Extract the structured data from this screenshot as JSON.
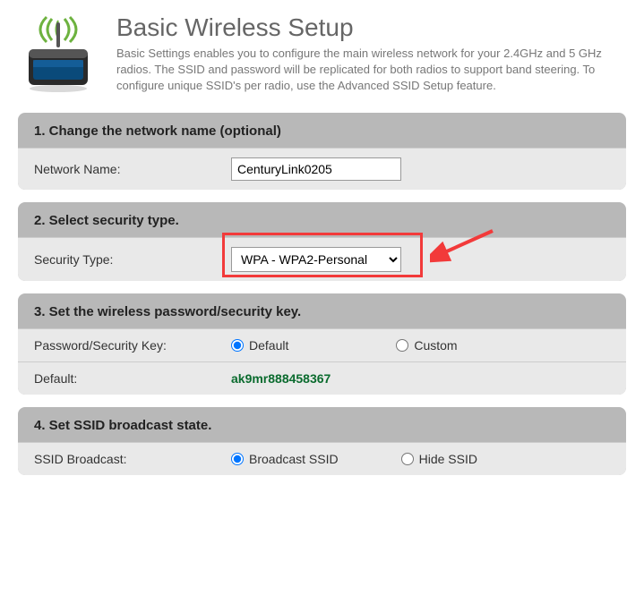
{
  "header": {
    "title": "Basic Wireless Setup",
    "description": "Basic Settings enables you to configure the main wireless network for your 2.4GHz and 5 GHz radios. The SSID and password will be replicated for both radios to support band steering. To configure unique SSID's per radio, use the Advanced SSID Setup feature."
  },
  "section1": {
    "title": "1. Change the network name (optional)",
    "label": "Network Name:",
    "value": "CenturyLink0205"
  },
  "section2": {
    "title": "2. Select security type.",
    "label": "Security Type:",
    "selected": "WPA - WPA2-Personal"
  },
  "section3": {
    "title": "3. Set the wireless password/security key.",
    "row1": {
      "label": "Password/Security Key:",
      "opt_default": "Default",
      "opt_custom": "Custom"
    },
    "row2": {
      "label": "Default:",
      "value": "ak9mr888458367"
    }
  },
  "section4": {
    "title": "4. Set SSID broadcast state.",
    "label": "SSID Broadcast:",
    "opt_broadcast": "Broadcast SSID",
    "opt_hide": "Hide SSID"
  }
}
